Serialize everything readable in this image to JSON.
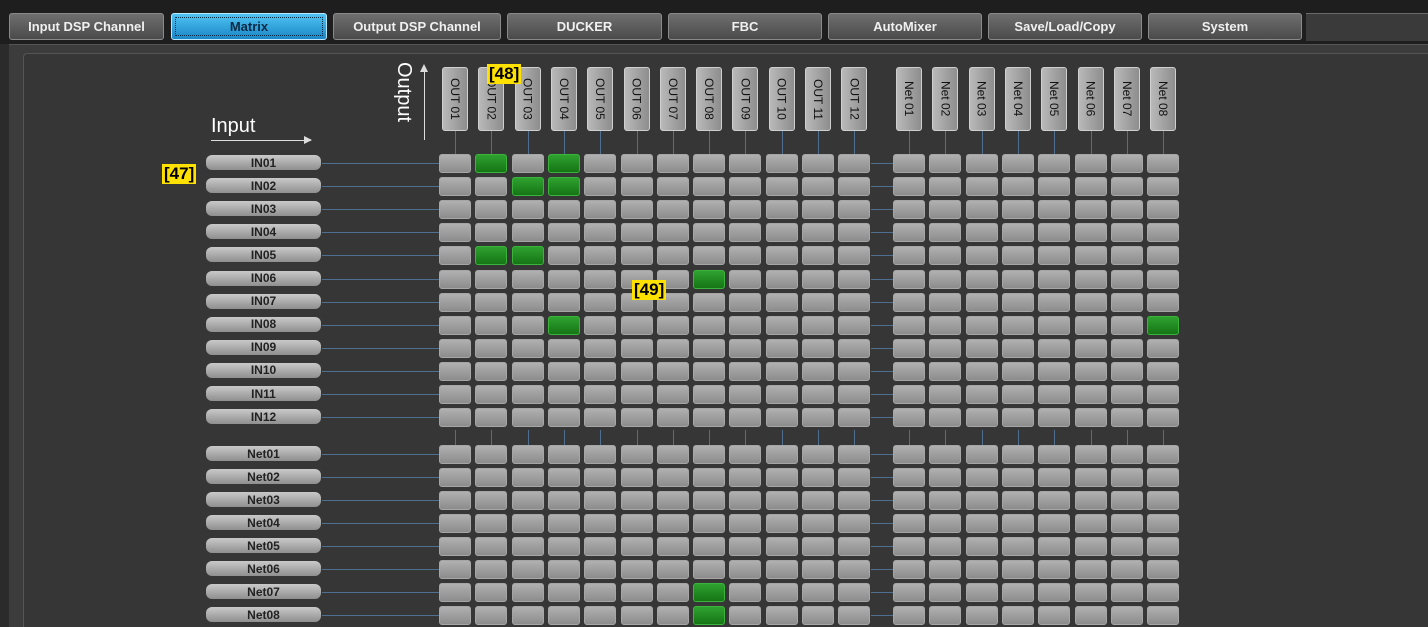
{
  "tabs": [
    {
      "label": "Input DSP Channel",
      "active": false
    },
    {
      "label": "Matrix",
      "active": true
    },
    {
      "label": "Output DSP Channel",
      "active": false
    },
    {
      "label": "DUCKER",
      "active": false
    },
    {
      "label": "FBC",
      "active": false
    },
    {
      "label": "AutoMixer",
      "active": false
    },
    {
      "label": "Save/Load/Copy",
      "active": false
    },
    {
      "label": "System",
      "active": false
    }
  ],
  "matrix": {
    "input_label": "Input",
    "output_label": "Output",
    "outputs": [
      "OUT 01",
      "OUT 02",
      "OUT 03",
      "OUT 04",
      "OUT 05",
      "OUT 06",
      "OUT 07",
      "OUT 08",
      "OUT 09",
      "OUT 10",
      "OUT 11",
      "OUT 12",
      "Net 01",
      "Net 02",
      "Net 03",
      "Net 04",
      "Net 05",
      "Net 06",
      "Net 07",
      "Net 08"
    ],
    "inputs": [
      "IN01",
      "IN02",
      "IN03",
      "IN04",
      "IN05",
      "IN06",
      "IN07",
      "IN08",
      "IN09",
      "IN10",
      "IN11",
      "IN12",
      "Net01",
      "Net02",
      "Net03",
      "Net04",
      "Net05",
      "Net06",
      "Net07",
      "Net08"
    ],
    "active_routes": [
      [
        0,
        1
      ],
      [
        0,
        3
      ],
      [
        1,
        2
      ],
      [
        1,
        3
      ],
      [
        4,
        1
      ],
      [
        4,
        2
      ],
      [
        5,
        7
      ],
      [
        7,
        3
      ],
      [
        7,
        19
      ],
      [
        18,
        7
      ],
      [
        19,
        7
      ]
    ],
    "active_color": "#1f8a1f",
    "inactive_color": "#9e9e9e",
    "accent_color": "#2ea3dc"
  },
  "markers": [
    "[47]",
    "[48]",
    "[49]"
  ]
}
